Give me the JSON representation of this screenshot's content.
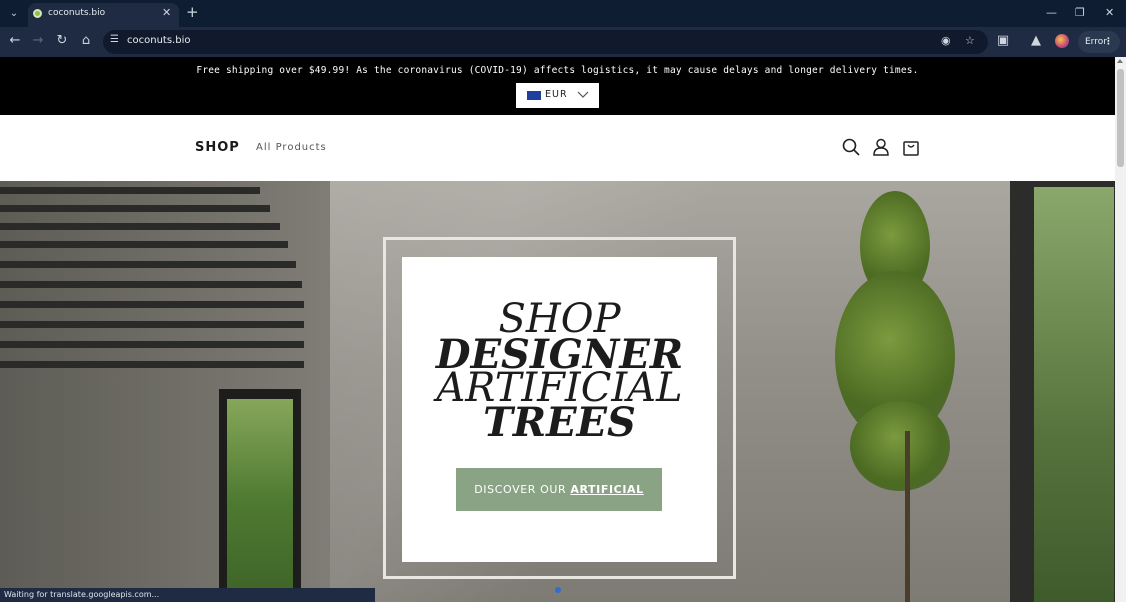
{
  "browser": {
    "tab": {
      "title": "coconuts.bio",
      "favicon": "globe-icon"
    },
    "url": "coconuts.bio",
    "profile_chip": "Error",
    "status_text": "Waiting for translate.googleapis.com..."
  },
  "page": {
    "announcement": "Free shipping over $49.99! As the coronavirus (COVID-19) affects logistics, it may cause delays and longer delivery times.",
    "currency": {
      "code": "EUR",
      "flag": "eu-flag-icon"
    },
    "header": {
      "logo": "SHOP",
      "nav": [
        "All Products"
      ],
      "icons": [
        "search-icon",
        "account-icon",
        "cart-icon"
      ]
    },
    "hero": {
      "lines": [
        "SHOP",
        "DESIGNER",
        "ARTIFICIAL",
        "TREES"
      ],
      "cta_prefix": "DISCOVER OUR",
      "cta_link": "ARTIFICIAL TREES"
    }
  },
  "colors": {
    "announcement_bg": "#000000",
    "cta_bg": "#8aa384",
    "slider_dot": "#2f6fd0"
  }
}
